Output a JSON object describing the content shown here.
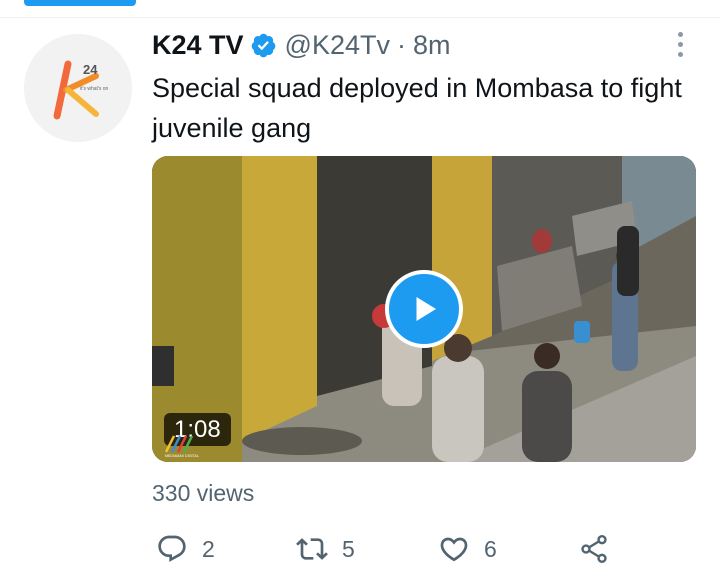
{
  "tweet": {
    "author_name": "K24 TV",
    "author_handle": "@K24Tv",
    "separator": "·",
    "time_ago": "8m",
    "text": "Special squad deployed in Mombasa to fight juvenile gang",
    "avatar": {
      "logo_text": "24",
      "tagline": "it's what's on"
    },
    "media": {
      "type": "video",
      "duration": "1:08",
      "watermark": "MEDIAMAX DIGITAL"
    },
    "views_label": "330 views",
    "actions": {
      "reply_count": "2",
      "retweet_count": "5",
      "like_count": "6"
    },
    "colors": {
      "accent": "#1d9bf0",
      "secondary_text": "#536471",
      "primary_text": "#0f1419",
      "logo_orange": "#f28c28"
    },
    "icons": [
      "verified-badge-icon",
      "more-options-icon",
      "play-icon",
      "reply-icon",
      "retweet-icon",
      "like-icon",
      "share-icon"
    ]
  }
}
